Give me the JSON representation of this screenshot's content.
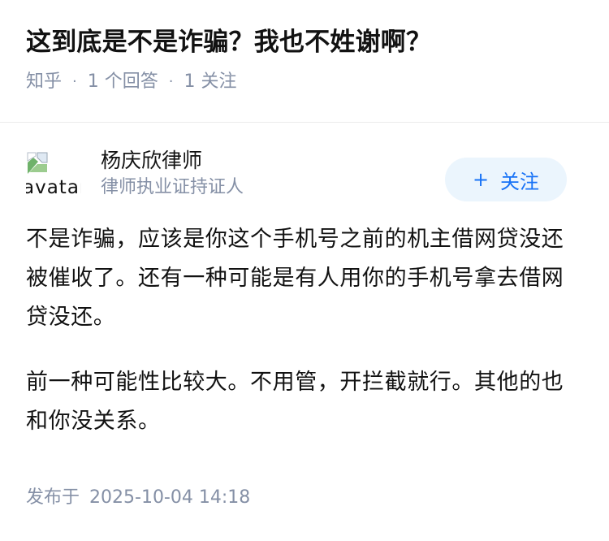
{
  "question": {
    "title": "这到底是不是诈骗？我也不姓谢啊？",
    "source": "知乎",
    "separator": "·",
    "answer_count": "1 个回答",
    "follower_count": "1 关注"
  },
  "answer": {
    "author": {
      "avatar_alt": "avatar",
      "name": "杨庆欣律师",
      "headline": "律师执业证持证人"
    },
    "follow_button": {
      "icon": "+",
      "label": "关注"
    },
    "paragraphs": [
      "不是诈骗，应该是你这个手机号之前的机主借网贷没还被催收了。还有一种可能是有人用你的手机号拿去借网贷没还。",
      "前一种可能性比较大。不用管，开拦截就行。其他的也和你没关系。"
    ],
    "time_label": "发布于",
    "time_value": "2025-10-04 14:18"
  },
  "colors": {
    "meta_gray": "#8590a6",
    "accent_blue": "#1772f6",
    "follow_bg": "#ebf5fd",
    "divider": "#ebebeb"
  }
}
